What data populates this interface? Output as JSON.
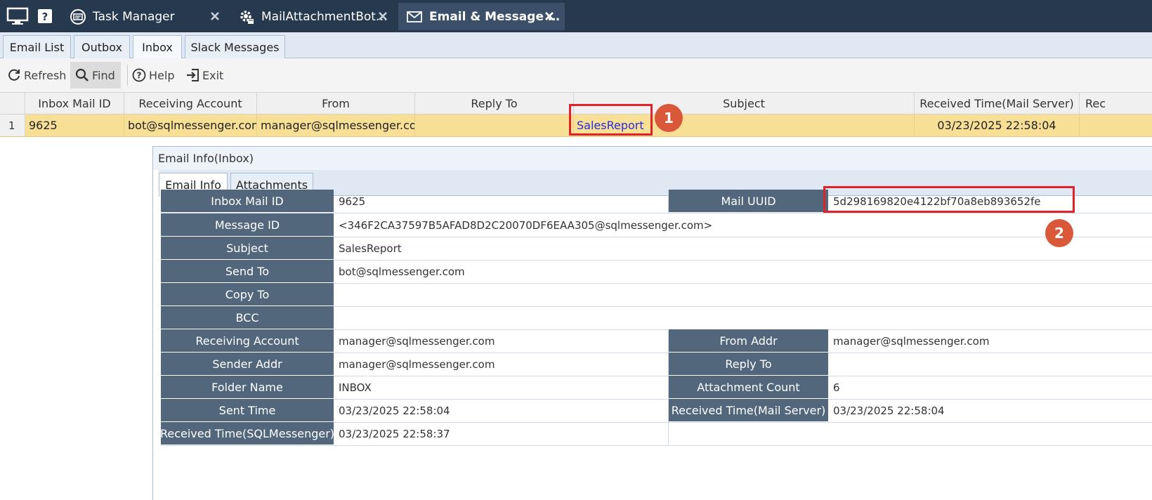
{
  "app_tabs": [
    {
      "label": "Task Manager",
      "icon": "task-manager-icon"
    },
    {
      "label": "MailAttachmentBot…",
      "icon": "gear-icon"
    },
    {
      "label": "Email & Message …",
      "icon": "envelope-icon"
    }
  ],
  "sub_tabs": [
    "Email List",
    "Outbox",
    "Inbox",
    "Slack Messages"
  ],
  "toolbar": {
    "refresh": "Refresh",
    "find": "Find",
    "help": "Help",
    "exit": "Exit"
  },
  "grid": {
    "columns": [
      "Inbox Mail ID",
      "Receiving Account",
      "From",
      "Reply To",
      "Subject",
      "Received Time(Mail Server)",
      "Rec"
    ],
    "rows": [
      {
        "num": "1",
        "id": "9625",
        "account": "bot@sqlmessenger.com",
        "from": "manager@sqlmessenger.com",
        "reply_to": "",
        "subject": "SalesReport",
        "received": "03/23/2025 22:58:04",
        "rec": ""
      }
    ]
  },
  "badges": {
    "one": "1",
    "two": "2"
  },
  "panel": {
    "title": "Email Info(Inbox)",
    "tabs": [
      "Email Info",
      "Attachments"
    ],
    "fields": {
      "inbox_mail_id": {
        "label": "Inbox Mail ID",
        "value": "9625"
      },
      "mail_uuid": {
        "label": "Mail UUID",
        "value": "5d298169820e4122bf70a8eb893652fe"
      },
      "message_id": {
        "label": "Message ID",
        "value": "<346F2CA37597B5AFAD8D2C20070DF6EAA305@sqlmessenger.com>"
      },
      "subject": {
        "label": "Subject",
        "value": "SalesReport"
      },
      "send_to": {
        "label": "Send To",
        "value": "bot@sqlmessenger.com"
      },
      "copy_to": {
        "label": "Copy To",
        "value": ""
      },
      "bcc": {
        "label": "BCC",
        "value": ""
      },
      "receiving_account": {
        "label": "Receiving Account",
        "value": "manager@sqlmessenger.com"
      },
      "from_addr": {
        "label": "From Addr",
        "value": "manager@sqlmessenger.com"
      },
      "sender_addr": {
        "label": "Sender Addr",
        "value": "manager@sqlmessenger.com"
      },
      "reply_to": {
        "label": "Reply To",
        "value": ""
      },
      "folder_name": {
        "label": "Folder Name",
        "value": "INBOX"
      },
      "attachment_count": {
        "label": "Attachment Count",
        "value": "6"
      },
      "sent_time": {
        "label": "Sent Time",
        "value": "03/23/2025 22:58:04"
      },
      "received_time_server": {
        "label": "Received Time(Mail Server)",
        "value": "03/23/2025 22:58:04"
      },
      "received_time_sqlm": {
        "label": "Received Time(SQLMessenger)",
        "value": "03/23/2025 22:58:37"
      }
    }
  },
  "colors": {
    "topbar": "#26394f",
    "label_bg": "#52677c",
    "selected_row": "#f8df96",
    "highlight": "#e0222a",
    "badge": "#d9583a"
  }
}
